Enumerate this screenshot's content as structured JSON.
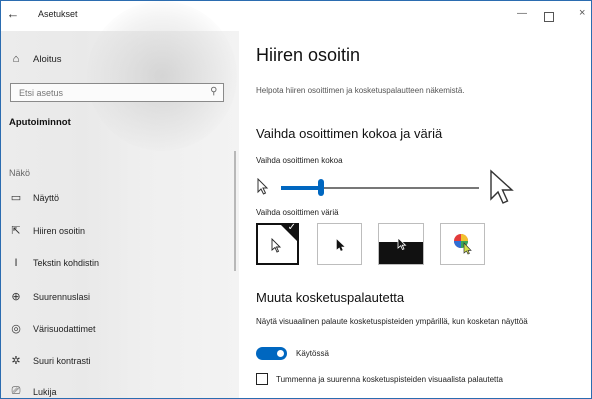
{
  "window": {
    "title": "Asetukset",
    "back_glyph": "←",
    "minimize_glyph": "—",
    "close_glyph": "×"
  },
  "sidebar": {
    "home": {
      "label": "Aloitus",
      "icon": "home-icon"
    },
    "search": {
      "placeholder": "Etsi asetus",
      "icon": "search-icon"
    },
    "section_title": "Aputoiminnot",
    "group_label": "Näkö",
    "items": [
      {
        "label": "Näyttö",
        "icon": "monitor-icon"
      },
      {
        "label": "Hiiren osoitin",
        "icon": "mouse-pointer-icon"
      },
      {
        "label": "Tekstin kohdistin",
        "icon": "text-cursor-icon"
      },
      {
        "label": "Suurennuslasi",
        "icon": "magnifier-icon"
      },
      {
        "label": "Värisuodattimet",
        "icon": "color-filter-icon"
      },
      {
        "label": "Suuri kontrasti",
        "icon": "contrast-icon"
      },
      {
        "label": "Lukija",
        "icon": "narrator-icon"
      }
    ]
  },
  "main": {
    "title": "Hiiren osoitin",
    "subtitle": "Helpota hiiren osoittimen ja kosketuspalautteen näkemistä.",
    "size_section": {
      "heading": "Vaihda osoittimen kokoa ja väriä",
      "size_label": "Vaihda osoittimen kokoa",
      "size_value_fraction": 0.2,
      "color_label": "Vaihda osoittimen väriä",
      "color_options": [
        {
          "name": "white",
          "selected": true
        },
        {
          "name": "black",
          "selected": false
        },
        {
          "name": "inverted",
          "selected": false
        },
        {
          "name": "custom",
          "selected": false
        }
      ]
    },
    "touch_section": {
      "heading": "Muuta kosketuspalautetta",
      "description": "Näytä visuaalinen palaute kosketuspisteiden ympärillä, kun kosketan näyttöä",
      "toggle_on": true,
      "toggle_label": "Käytössä",
      "checkbox_checked": false,
      "checkbox_label": "Tummenna ja suurenna kosketuspisteiden visuaalista palautetta"
    }
  },
  "colors": {
    "accent": "#0067c0",
    "sidebar_bg": "#ececec"
  }
}
